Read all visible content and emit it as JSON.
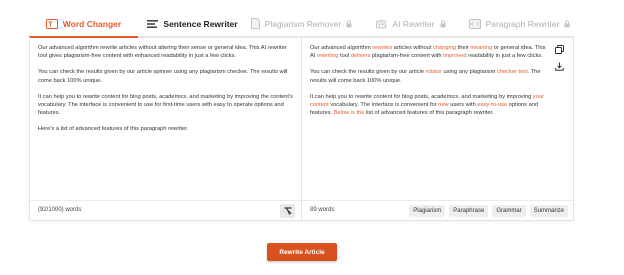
{
  "tabs": [
    {
      "label": "Word Changer",
      "icon": "text-edit-icon",
      "state": "active"
    },
    {
      "label": "Sentence Rewriter",
      "icon": "sentence-icon",
      "state": "enabled"
    },
    {
      "label": "Plagiarism Remover",
      "icon": "document-icon",
      "state": "locked"
    },
    {
      "label": "AI Rewriter",
      "icon": "robot-icon",
      "state": "locked"
    },
    {
      "label": "Paragraph Rewriter",
      "icon": "paragraph-icon",
      "state": "locked"
    }
  ],
  "input": {
    "paragraphs": [
      "Our advanced algorithm rewrite articles without altering their sense or general idea. This AI rewriter tool gives plagiarism-free content with enhanced readability in just a few clicks.",
      "You can check the results given by our article spinner using any plagiarism checker. The results will come back 100% unique.",
      "It can help you to rewrite content for blog posts, academics, and marketing by improving the content's vocabulary. The interface is convenient to use for first-time users with easy to operate options and features.",
      "Here's a list of advanced features of this paragraph rewriter."
    ],
    "word_count": "(92/1000) words"
  },
  "output": {
    "paragraphs": [
      [
        {
          "t": "Our advanced algorithm "
        },
        {
          "t": "rewrites",
          "hl": true
        },
        {
          "t": " articles without "
        },
        {
          "t": "changing",
          "hl": true
        },
        {
          "t": " their "
        },
        {
          "t": "meaning",
          "hl": true
        },
        {
          "t": " or general idea. This AI "
        },
        {
          "t": "rewriting",
          "hl": true
        },
        {
          "t": " tool "
        },
        {
          "t": "delivers",
          "hl": true
        },
        {
          "t": " plagiarism-free content with "
        },
        {
          "t": "improved",
          "hl": true
        },
        {
          "t": " readability in just a few clicks."
        }
      ],
      [
        {
          "t": "You can check the results given by our article "
        },
        {
          "t": "rotator",
          "hl": true
        },
        {
          "t": " using any plagiarism "
        },
        {
          "t": "checker tool",
          "hl": true
        },
        {
          "t": ". The results will come back 100% unique."
        }
      ],
      [
        {
          "t": "It can help you to rewrite content for blog posts, academics, and marketing by improving "
        },
        {
          "t": "your content",
          "hl": true
        },
        {
          "t": " vocabulary. The interface is convenient for "
        },
        {
          "t": "new",
          "hl": true
        },
        {
          "t": " users with "
        },
        {
          "t": "easy-to-use",
          "hl": true
        },
        {
          "t": " options and features. "
        },
        {
          "t": "Below is the",
          "hl": true
        },
        {
          "t": " list of advanced features of this paragraph rewriter."
        }
      ]
    ],
    "word_count": "89 words",
    "checks": [
      "Plagiarism",
      "Paraphrase",
      "Grammar",
      "Summarize"
    ]
  },
  "actions": {
    "rewrite_label": "Rewrite Article"
  },
  "colors": {
    "accent": "#e65b2e",
    "button": "#d9511f"
  }
}
